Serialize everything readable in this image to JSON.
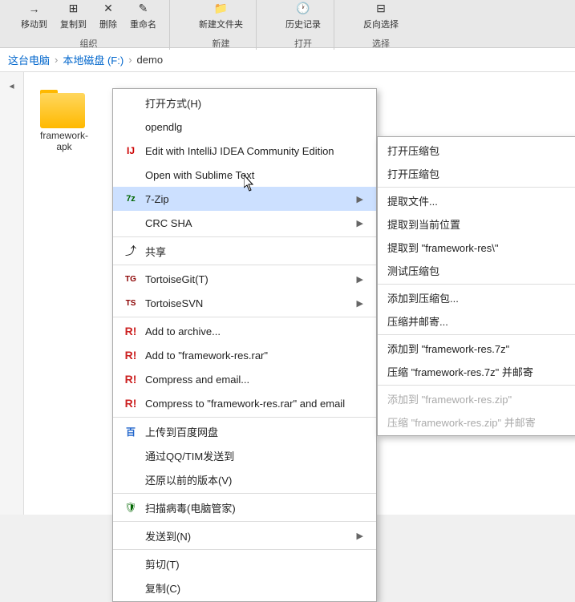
{
  "toolbar": {
    "groups": [
      {
        "label": "组织",
        "buttons": [
          "移动到",
          "复制到",
          "删除",
          "重命名"
        ]
      },
      {
        "label": "新建",
        "buttons": [
          "新建文件夹"
        ]
      },
      {
        "label": "打开",
        "buttons": [
          "历史记录"
        ]
      },
      {
        "label": "选择",
        "buttons": [
          "反向选择"
        ]
      }
    ]
  },
  "breadcrumb": {
    "items": [
      "这台电脑",
      "本地磁盘 (F:)",
      "demo"
    ]
  },
  "folder": {
    "name": "framework-\napk",
    "name_display": "framework-\napk"
  },
  "context_menu": {
    "items": [
      {
        "id": "open-with",
        "label": "打开方式(H)",
        "icon": "",
        "has_submenu": false
      },
      {
        "id": "opendlg",
        "label": "opendlg",
        "icon": "",
        "has_submenu": false
      },
      {
        "id": "intellij",
        "label": "Edit with IntelliJ IDEA Community Edition",
        "icon": "idea",
        "has_submenu": false
      },
      {
        "id": "sublime",
        "label": "Open with Sublime Text",
        "icon": "",
        "has_submenu": false
      },
      {
        "id": "7zip",
        "label": "7-Zip",
        "icon": "7zip",
        "has_submenu": true,
        "highlighted": true
      },
      {
        "id": "crcsha",
        "label": "CRC SHA",
        "icon": "",
        "has_submenu": true
      },
      {
        "id": "share",
        "label": "共享",
        "icon": "share",
        "has_submenu": false
      },
      {
        "id": "tortoisegit",
        "label": "TortoiseGit(T)",
        "icon": "tgit",
        "has_submenu": true
      },
      {
        "id": "tortoisesvn",
        "label": "TortoiseSVN",
        "icon": "tsvn",
        "has_submenu": true
      },
      {
        "id": "add-archive",
        "label": "Add to archive...",
        "icon": "rar",
        "has_submenu": false
      },
      {
        "id": "add-rar",
        "label": "Add to \"framework-res.rar\"",
        "icon": "rar",
        "has_submenu": false
      },
      {
        "id": "compress-email",
        "label": "Compress and email...",
        "icon": "rar",
        "has_submenu": false
      },
      {
        "id": "compress-rar-email",
        "label": "Compress to \"framework-res.rar\" and email",
        "icon": "rar",
        "has_submenu": false
      },
      {
        "id": "baidu",
        "label": "上传到百度网盘",
        "icon": "baidu",
        "has_submenu": false
      },
      {
        "id": "qqtim",
        "label": "通过QQ/TIM发送到",
        "icon": "",
        "has_submenu": false
      },
      {
        "id": "restore",
        "label": "还原以前的版本(V)",
        "icon": "",
        "has_submenu": false
      },
      {
        "id": "antivirus",
        "label": "扫描病毒(电脑管家)",
        "icon": "antivirus",
        "has_submenu": false
      },
      {
        "id": "sendto",
        "label": "发送到(N)",
        "icon": "",
        "has_submenu": true
      },
      {
        "id": "cut",
        "label": "剪切(T)",
        "icon": "",
        "has_submenu": false
      },
      {
        "id": "copy",
        "label": "复制(C)",
        "icon": "",
        "has_submenu": false
      }
    ]
  },
  "submenu_7zip": {
    "items": [
      {
        "id": "open-archive",
        "label": "打开压缩包",
        "disabled": false
      },
      {
        "id": "open-archive2",
        "label": "打开压缩包",
        "disabled": false
      },
      {
        "id": "extract-files",
        "label": "提取文件...",
        "disabled": false
      },
      {
        "id": "extract-here",
        "label": "提取到当前位置",
        "disabled": false
      },
      {
        "id": "extract-folder",
        "label": "提取到 \"framework-res\\\"",
        "disabled": false
      },
      {
        "id": "test-archive",
        "label": "测试压缩包",
        "disabled": false
      },
      {
        "id": "add-archive2",
        "label": "添加到压缩包...",
        "disabled": false
      },
      {
        "id": "compress-email2",
        "label": "压缩并邮寄...",
        "disabled": false
      },
      {
        "id": "add-7z",
        "label": "添加到 \"framework-res.7z\"",
        "disabled": false
      },
      {
        "id": "compress-7z-email",
        "label": "压缩 \"framework-res.7z\" 并邮寄",
        "disabled": false
      },
      {
        "id": "add-zip",
        "label": "添加到 \"framework-res.zip\"",
        "disabled": true
      },
      {
        "id": "compress-zip-email",
        "label": "压缩 \"framework-res.zip\" 并邮寄",
        "disabled": true
      }
    ]
  }
}
